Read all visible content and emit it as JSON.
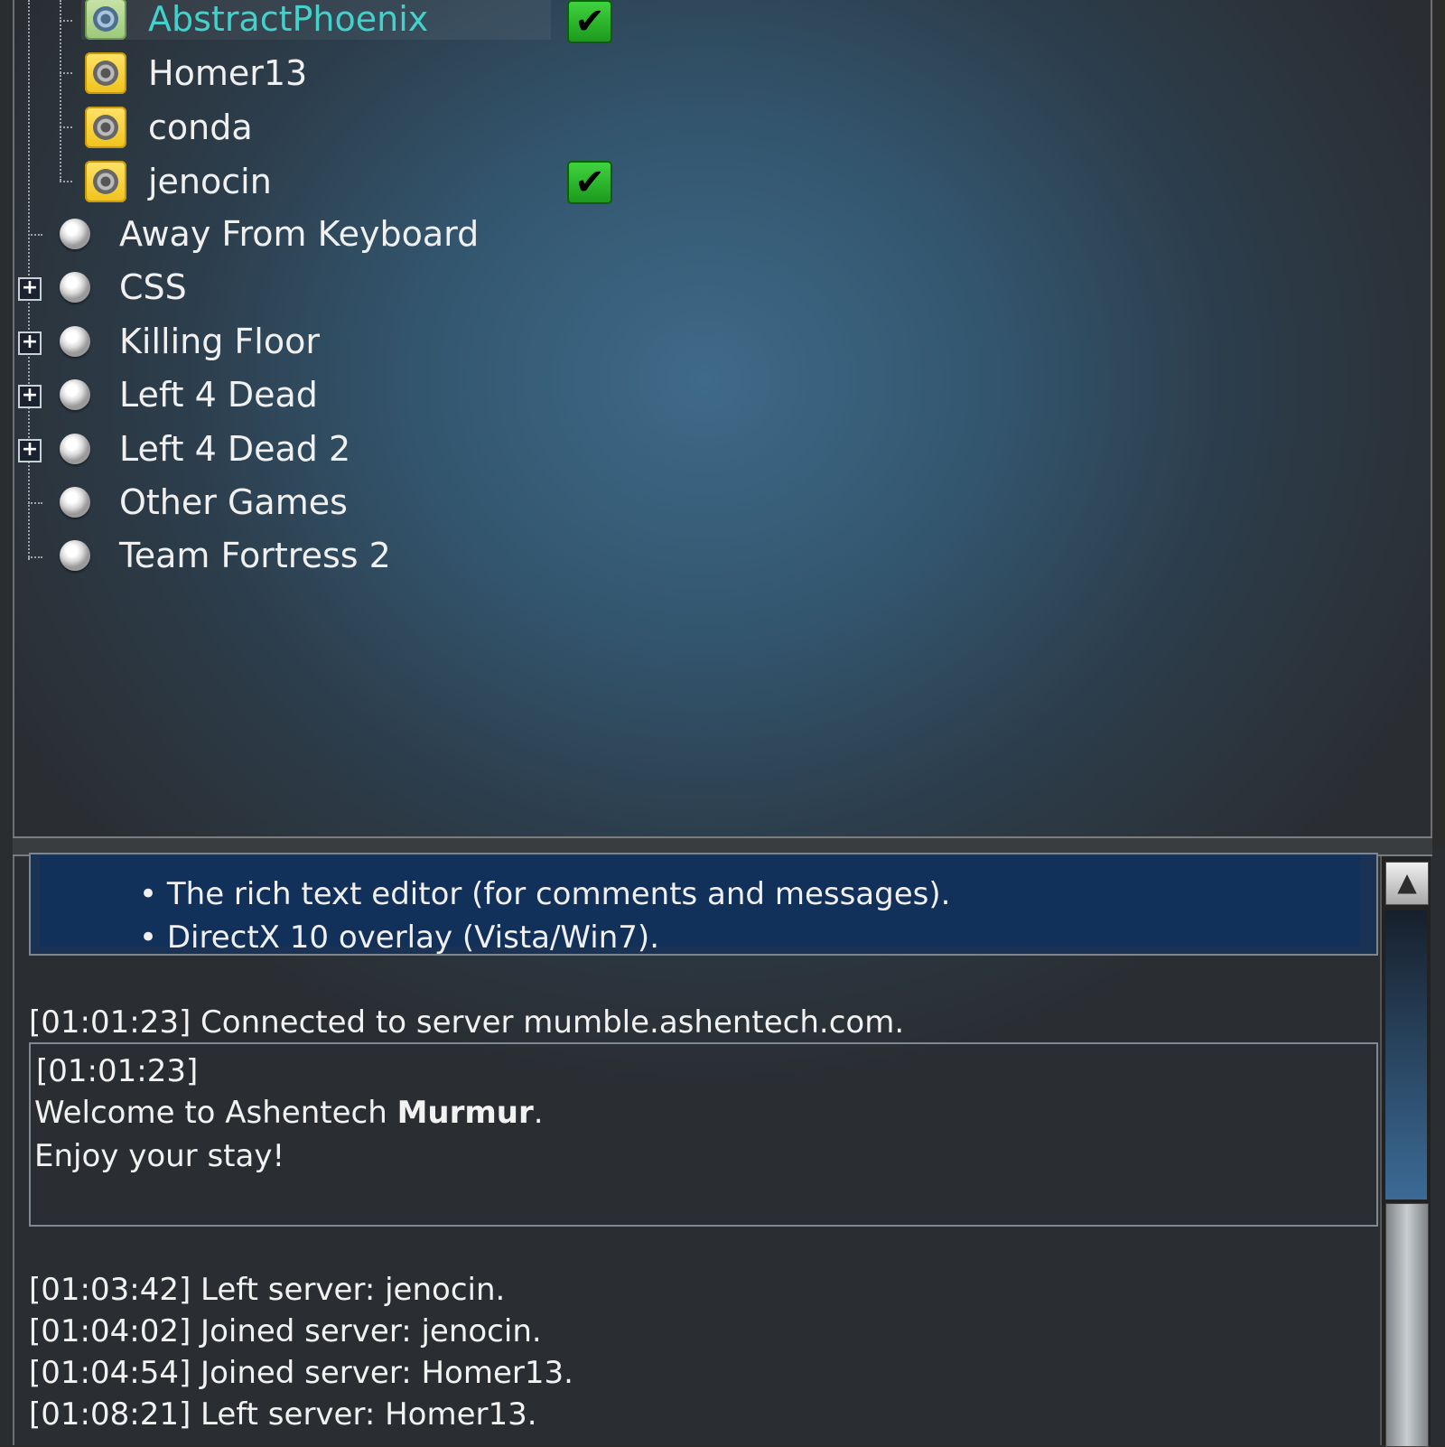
{
  "tree": {
    "users": [
      {
        "name": "AbstractPhoenix",
        "checked": true,
        "active": true
      },
      {
        "name": "Homer13",
        "checked": false,
        "active": false
      },
      {
        "name": "conda",
        "checked": false,
        "active": false
      },
      {
        "name": "jenocin",
        "checked": true,
        "active": false
      }
    ],
    "channels": [
      {
        "name": "Away From Keyboard",
        "expandable": false
      },
      {
        "name": "CSS",
        "expandable": true
      },
      {
        "name": "Killing Floor",
        "expandable": true
      },
      {
        "name": "Left 4 Dead",
        "expandable": true
      },
      {
        "name": "Left 4 Dead 2",
        "expandable": true
      },
      {
        "name": "Other Games",
        "expandable": false
      },
      {
        "name": "Team Fortress 2",
        "expandable": false
      }
    ],
    "check_glyph": "✔",
    "expand_glyph": "+"
  },
  "log": {
    "changes": [
      "The rich text editor (for comments and messages).",
      "DirectX 10 overlay (Vista/Win7)."
    ],
    "connected": "[01:01:23] Connected to server mumble.ashentech.com.",
    "welcome": {
      "time": "[01:01:23]",
      "prefix": "Welcome to Ashentech ",
      "bold": "Murmur",
      "suffix": ".",
      "line2": "Enjoy your stay!"
    },
    "events": [
      "[01:03:42] Left server: jenocin.",
      "[01:04:02] Joined server: jenocin.",
      "[01:04:54] Joined server: Homer13.",
      "[01:08:21] Left server: Homer13."
    ]
  },
  "scrollbar": {
    "up_glyph": "▲"
  },
  "colors": {
    "highlight_name": "#37d0c8",
    "check_green": "#2fbf2f",
    "selection_blue": "#12315a"
  }
}
